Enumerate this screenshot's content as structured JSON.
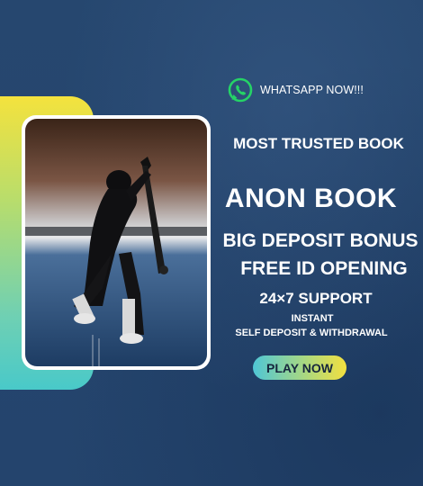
{
  "whatsapp": {
    "label": "WHATSAPP NOW!!!",
    "icon": "whatsapp-icon"
  },
  "headline": {
    "trusted": "MOST TRUSTED BOOK",
    "brand": "ANON BOOK",
    "bonus": "BIG DEPOSIT BONUS",
    "free_id": "FREE ID OPENING",
    "support": "24×7 SUPPORT",
    "instant": "INSTANT",
    "self_deposit": "SELF DEPOSIT & WITHDRAWAL"
  },
  "cta": {
    "label": "PLAY NOW"
  },
  "colors": {
    "background": "#24456f",
    "accent_yellow": "#f3e03f",
    "accent_teal": "#4fc6d6",
    "whatsapp_green": "#25d366"
  }
}
